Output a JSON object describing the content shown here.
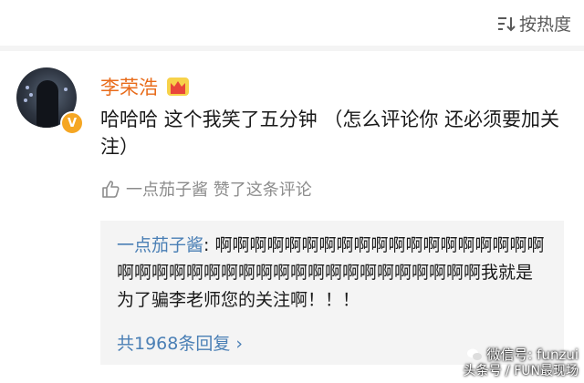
{
  "header": {
    "sort_label": "按热度",
    "sort_icon": "sort-icon"
  },
  "comment": {
    "username": "李荣浩",
    "badge_icon": "crown-icon",
    "verified_mark": "V",
    "text": "哈哈哈 这个我笑了五分钟 （怎么评论你 还必须要加关注）",
    "likes_text": "一点茄子酱 赞了这条评论"
  },
  "reply": {
    "author": "一点茄子酱",
    "text": ": 啊啊啊啊啊啊啊啊啊啊啊啊啊啊啊啊啊啊啊啊啊啊啊啊啊啊啊啊啊啊啊啊啊啊啊啊啊啊啊啊我就是为了骗李老师您的关注啊！！！",
    "count_label": "共1968条回复 ›"
  },
  "watermark": {
    "line1": "微信号: funzui",
    "line2": "头条号 / FUN最现场"
  },
  "colors": {
    "username": "#e86b1a",
    "link": "#4a7fb5",
    "verified": "#f5a623"
  }
}
